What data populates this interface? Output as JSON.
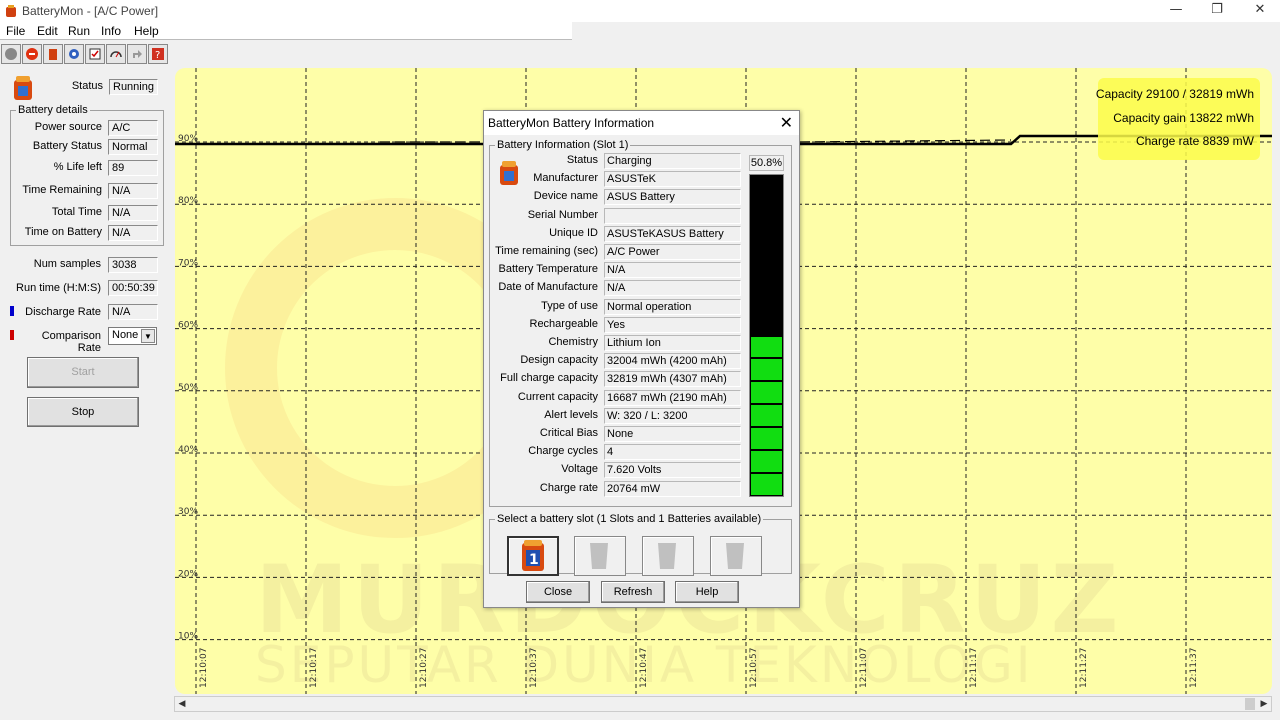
{
  "window": {
    "title": "BatteryMon - [A/C Power]",
    "min": "—",
    "restore": "❐",
    "close": "✕"
  },
  "menu": [
    "File",
    "Edit",
    "Run",
    "Info",
    "Help"
  ],
  "status": {
    "label": "Status",
    "value": "Running"
  },
  "battery_details": {
    "title": "Battery details",
    "rows": [
      {
        "label": "Power source",
        "value": "A/C"
      },
      {
        "label": "Battery Status",
        "value": "Normal"
      },
      {
        "label": "% Life left",
        "value": "89"
      },
      {
        "label": "Time Remaining",
        "value": "N/A"
      },
      {
        "label": "Total Time",
        "value": "N/A"
      },
      {
        "label": "Time on Battery",
        "value": "N/A"
      }
    ]
  },
  "stats": [
    {
      "label": "Num samples",
      "value": "3038"
    },
    {
      "label": "Run time (H:M:S)",
      "value": "00:50:39"
    },
    {
      "label": "Discharge Rate",
      "value": "N/A"
    },
    {
      "label": "Comparison Rate",
      "value": "None"
    }
  ],
  "buttons": {
    "start": "Start",
    "stop": "Stop"
  },
  "chart": {
    "y_ticks": [
      "90%",
      "80%",
      "70%",
      "60%",
      "50%",
      "40%",
      "30%",
      "20%",
      "10%"
    ],
    "x_ticks": [
      "12:10:07",
      "12:10:17",
      "12:10:27",
      "12:10:37",
      "12:10:47",
      "12:10:57",
      "12:11:07",
      "12:11:17",
      "12:11:27",
      "12:11:37"
    ],
    "info": {
      "capacity": "Capacity 29100 / 32819 mWh",
      "gain": "Capacity gain 13822 mWh",
      "rate": "Charge rate 8839 mW"
    },
    "watermark1": "MURDOCKCRUZ",
    "watermark2": "SEPUTAR DUNIA TEKNOLOGI"
  },
  "dialog": {
    "title": "BatteryMon Battery Information",
    "group_title": "Battery Information (Slot 1)",
    "percent": "50.8%",
    "level_fraction": 0.508,
    "rows": [
      {
        "label": "Status",
        "value": "Charging"
      },
      {
        "label": "Manufacturer",
        "value": "ASUSTeK"
      },
      {
        "label": "Device name",
        "value": "ASUS Battery"
      },
      {
        "label": "Serial Number",
        "value": ""
      },
      {
        "label": "Unique ID",
        "value": "ASUSTeKASUS Battery"
      },
      {
        "label": "Time remaining (sec)",
        "value": "A/C Power"
      },
      {
        "label": "Battery Temperature",
        "value": "N/A"
      },
      {
        "label": "Date of Manufacture",
        "value": "N/A"
      },
      {
        "label": "Type of use",
        "value": "Normal operation"
      },
      {
        "label": "Rechargeable",
        "value": "Yes"
      },
      {
        "label": "Chemistry",
        "value": "Lithium Ion"
      },
      {
        "label": "Design capacity",
        "value": "32004 mWh (4200 mAh)"
      },
      {
        "label": "Full charge capacity",
        "value": "32819 mWh (4307 mAh)"
      },
      {
        "label": "Current capacity",
        "value": "16687 mWh (2190 mAh)"
      },
      {
        "label": "Alert levels",
        "value": "W: 320 / L: 3200"
      },
      {
        "label": "Critical Bias",
        "value": "None"
      },
      {
        "label": "Charge cycles",
        "value": "4"
      },
      {
        "label": "Voltage",
        "value": "7.620 Volts"
      },
      {
        "label": "Charge rate",
        "value": "20764 mW"
      }
    ],
    "slot_group_title": "Select a battery slot (1 Slots and 1 Batteries available)",
    "slot1_label": "1",
    "buttons": {
      "close": "Close",
      "refresh": "Refresh",
      "help": "Help"
    }
  },
  "colors": {
    "chart_bg": "#fefea8",
    "grid": "#000000",
    "level_green": "#11dd11",
    "level_empty": "#000000",
    "discharge": "#0000cc",
    "comparison": "#cc0000"
  }
}
